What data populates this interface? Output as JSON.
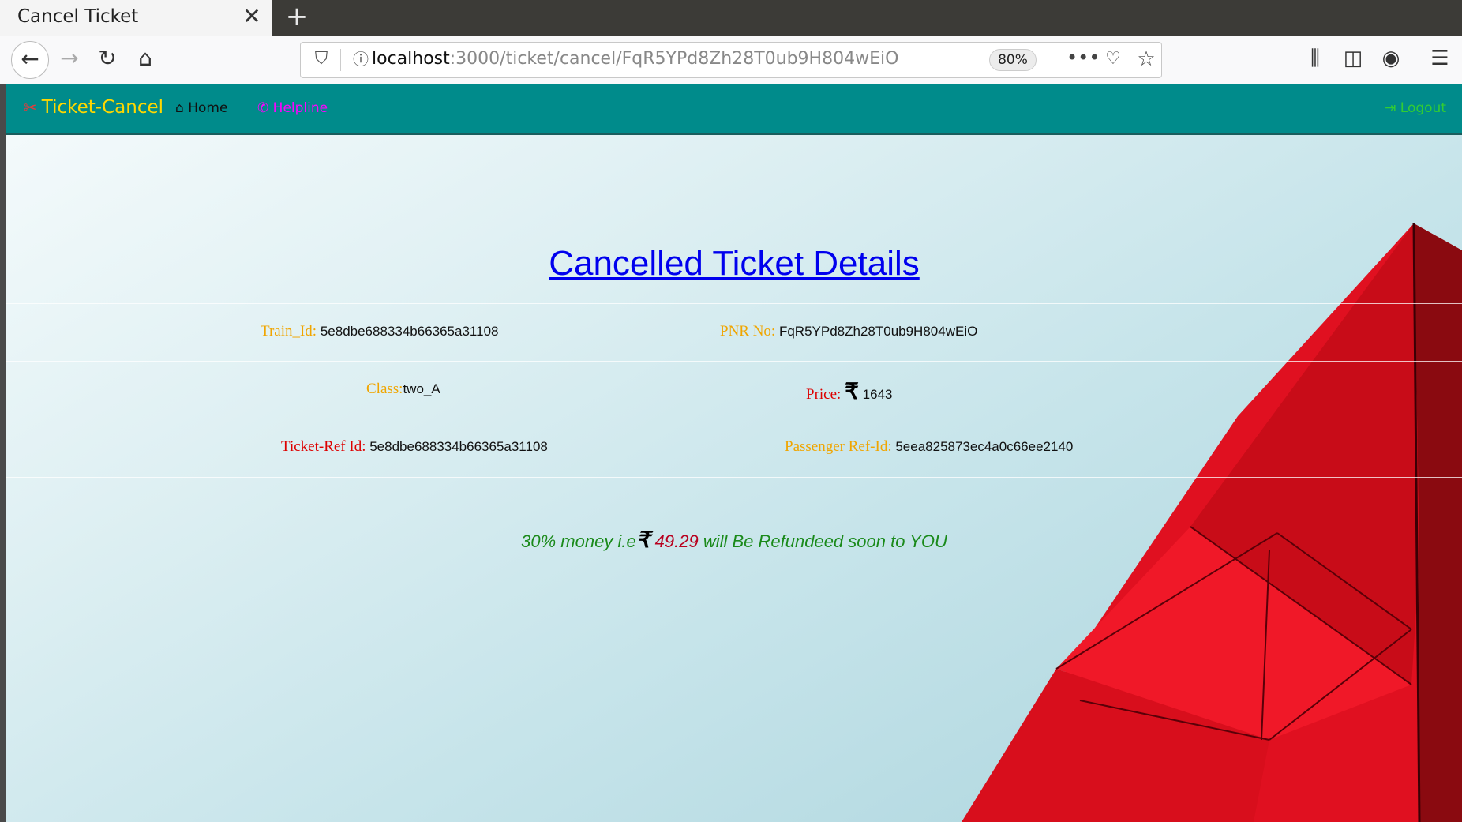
{
  "browser": {
    "tab_title": "Cancel Ticket",
    "url_host": "localhost",
    "url_path": ":3000/ticket/cancel/FqR5YPd8Zh28T0ub9H804wEiO",
    "zoom": "80%"
  },
  "navbar": {
    "brand": "Ticket-Cancel",
    "home": "Home",
    "helpline": "Helpline",
    "logout": "Logout"
  },
  "page": {
    "title": "Cancelled Ticket Details",
    "train_id_label": "Train_Id:",
    "train_id": "5e8dbe688334b66365a31108",
    "pnr_label": "PNR No:",
    "pnr": "FqR5YPd8Zh28T0ub9H804wEiO",
    "class_label": "Class:",
    "class_value": "two_A",
    "price_label": "Price:",
    "currency": "₹",
    "price": "1643",
    "ticket_ref_label": "Ticket-Ref Id:",
    "ticket_ref": "5e8dbe688334b66365a31108",
    "passenger_ref_label": "Passenger Ref-Id:",
    "passenger_ref": "5eea825873ec4a0c66ee2140",
    "refund_prefix": "30% money i.e",
    "refund_amount": "49.29",
    "refund_suffix": "will Be Refundeed soon to YOU"
  },
  "colors": {
    "navbar": "#008b8b",
    "brand": "#ffd700",
    "helpline": "#ff00ff",
    "logout": "#32cd32",
    "title": "#0000ee"
  }
}
